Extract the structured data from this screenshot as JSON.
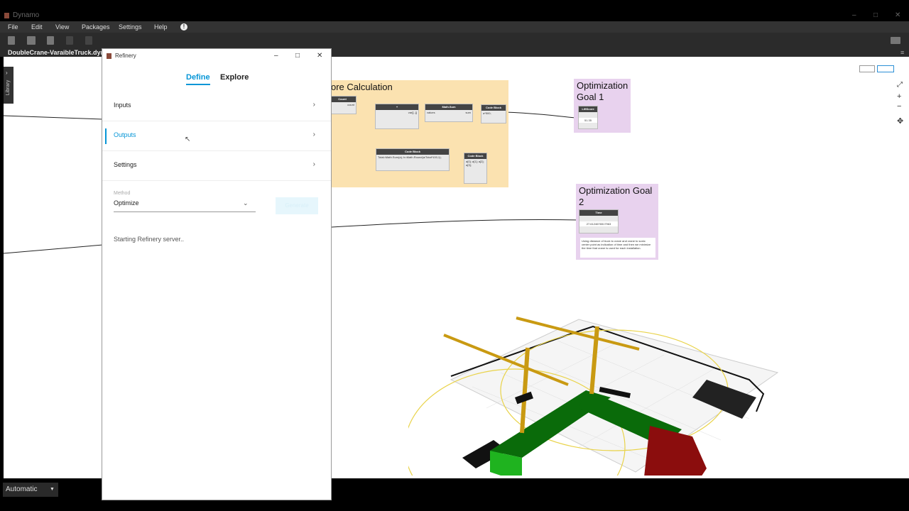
{
  "app": {
    "title": "Dynamo",
    "menu": [
      "File",
      "Edit",
      "View",
      "Packages",
      "Settings",
      "Help"
    ],
    "file_tab": "DoubleCrane-VaraibleTruck.dyn*",
    "library_tab": "Library",
    "run_mode": "Automatic"
  },
  "canvas": {
    "group_score": {
      "title": "ore Calculation"
    },
    "group_goal1": {
      "title": "Optimization Goal 1",
      "node_title": "LiftScore",
      "node_value": "51.35"
    },
    "group_goal2": {
      "title": "Optimization Goal 2",
      "node_title": "Time",
      "node_value": "27.6124676517963",
      "note": "Using distance of truck to crane and crane to sonic center point as indication of time and then we minimize the time that crane is used for each installation."
    },
    "nodes": {
      "count": {
        "title": "Count",
        "port": "count"
      },
      "plus": {
        "title": "+",
        "body": "var[]..[]"
      },
      "mathsum": {
        "title": "Math.Sum",
        "in": "values",
        "out": "sum"
      },
      "codeblock1": {
        "title": "Code Block",
        "body": "a*500;"
      },
      "codeblock2": {
        "title": "Code Block",
        "body": "Total=Math.Sum(a); b=Math.Round(a/Total*100,1);"
      },
      "codeblock3": {
        "title": "Code Block",
        "body": "a[0]; a[1]; a[2]; a[3];"
      }
    }
  },
  "refinery": {
    "window_title": "Refinery",
    "tabs": {
      "define": "Define",
      "explore": "Explore"
    },
    "rows": {
      "inputs": "Inputs",
      "outputs": "Outputs",
      "settings": "Settings"
    },
    "method_label": "Method",
    "method_value": "Optimize",
    "generate_button": "Generate",
    "status": "Starting Refinery server.."
  },
  "colors": {
    "accent": "#0696d7",
    "score_group": "#fbe2b0",
    "goal_group": "#e8d2ee",
    "crane": "#c99a12",
    "building_green": "#0a6b0a",
    "building_red": "#8b0d0d"
  }
}
